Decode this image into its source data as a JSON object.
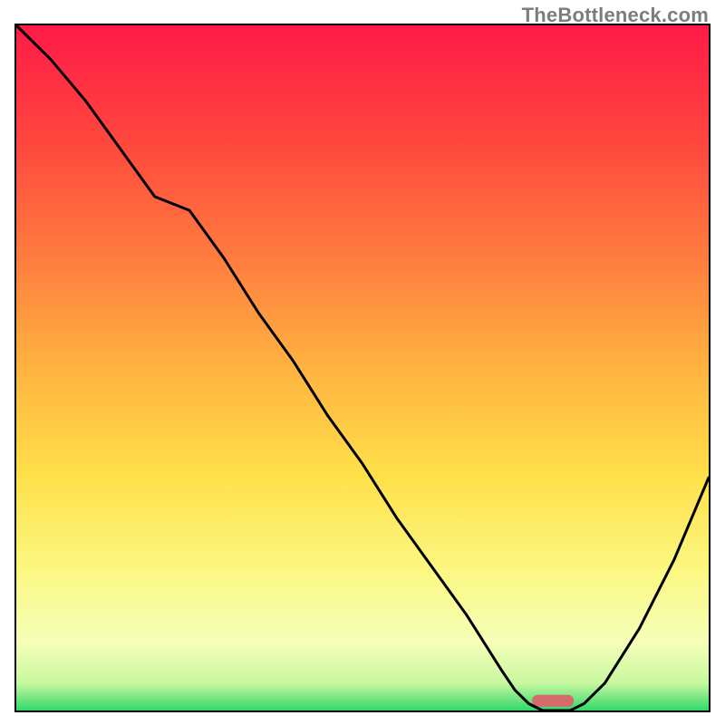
{
  "watermark": "TheBottleneck.com",
  "chart_data": {
    "type": "line",
    "x": [
      0,
      5,
      10,
      15,
      20,
      25,
      30,
      35,
      40,
      45,
      50,
      55,
      60,
      65,
      70,
      72,
      74,
      76,
      78,
      80,
      82,
      85,
      90,
      95,
      100
    ],
    "values": [
      100,
      95,
      89,
      82,
      75,
      73,
      66,
      58,
      51,
      43,
      36,
      28,
      21,
      14,
      6,
      3,
      1,
      0,
      0,
      0,
      1,
      4,
      12,
      22,
      34
    ],
    "title": "",
    "xlabel": "",
    "ylabel": "",
    "xlim": [
      0,
      100
    ],
    "ylim": [
      0,
      100
    ],
    "marker": {
      "x_start": 74.5,
      "x_end": 80.5,
      "y": 1.5,
      "color": "#d86a6d"
    },
    "gradient_stops": [
      {
        "offset": 0,
        "color": "#ff1a48"
      },
      {
        "offset": 0.18,
        "color": "#ff4a3d"
      },
      {
        "offset": 0.35,
        "color": "#ff8040"
      },
      {
        "offset": 0.5,
        "color": "#ffb340"
      },
      {
        "offset": 0.66,
        "color": "#ffe14a"
      },
      {
        "offset": 0.8,
        "color": "#fbf884"
      },
      {
        "offset": 0.9,
        "color": "#f5ffb8"
      },
      {
        "offset": 0.96,
        "color": "#c9f8a0"
      },
      {
        "offset": 1.0,
        "color": "#32d86a"
      }
    ]
  }
}
